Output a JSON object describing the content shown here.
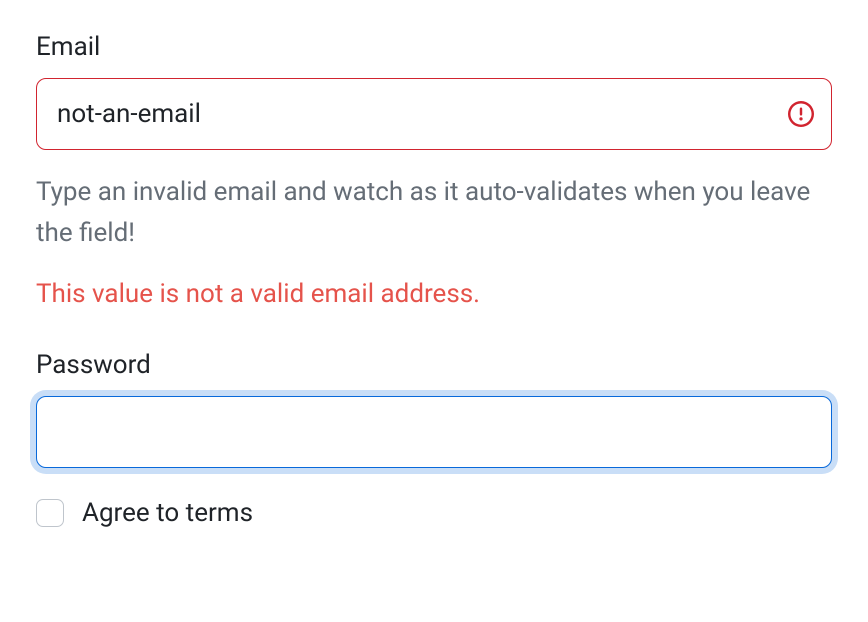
{
  "email": {
    "label": "Email",
    "value": "not-an-email",
    "placeholder": "",
    "hint": "Type an invalid email and watch as it auto-validates when you leave the field!",
    "error": "This value is not a valid email address."
  },
  "password": {
    "label": "Password",
    "value": "",
    "placeholder": ""
  },
  "terms": {
    "label": "Agree to terms",
    "checked": false
  }
}
